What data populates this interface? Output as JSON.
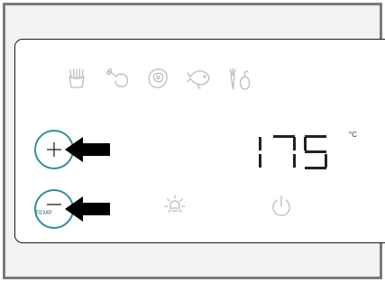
{
  "display": {
    "temperature": "175",
    "unit": "°C"
  },
  "buttons": {
    "minus_label": "TEMP"
  },
  "program_icons": [
    "fries-icon",
    "drumstick-icon",
    "steak-icon",
    "fish-icon",
    "vegetables-icon"
  ],
  "controls": {
    "plus": "plus-icon",
    "minus": "minus-icon",
    "light": "light-icon",
    "power": "power-icon"
  },
  "colors": {
    "button_ring": "#2f8f9d",
    "icons_inactive": "#bcbcbc",
    "arrows": "#000000",
    "panel_border": "#1a1a1a",
    "frame_border": "#7a7a7a",
    "background": "#f2f2f2"
  }
}
